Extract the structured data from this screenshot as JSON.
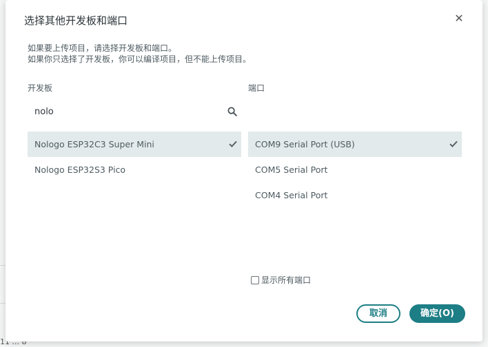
{
  "dialog": {
    "title": "选择其他开发板和端口",
    "info_line1": "如果要上传项目，请选择开发板和端口。",
    "info_line2": "如果你只选择了开发板，你可以编译项目，但不能上传项目。",
    "boards_label": "开发板",
    "ports_label": "端口",
    "search": {
      "value": "nolo"
    },
    "boards": [
      {
        "label": "Nologo ESP32C3 Super Mini",
        "selected": true
      },
      {
        "label": "Nologo ESP32S3 Pico",
        "selected": false
      }
    ],
    "ports": [
      {
        "label": "COM9 Serial Port (USB)",
        "selected": true
      },
      {
        "label": "COM5 Serial Port",
        "selected": false
      },
      {
        "label": "COM4 Serial Port",
        "selected": false
      }
    ],
    "show_all_ports_label": "显示所有端口",
    "show_all_ports_checked": false,
    "cancel_label": "取消",
    "ok_label": "确定(O)"
  },
  "background": {
    "status_fragment": "11 ... 8"
  },
  "icons": {
    "close": "close-icon",
    "search": "search-icon",
    "check": "check-icon"
  },
  "colors": {
    "accent": "#1d7e85",
    "selected_row": "#e3eaec",
    "backdrop": "#f4f5f5"
  }
}
